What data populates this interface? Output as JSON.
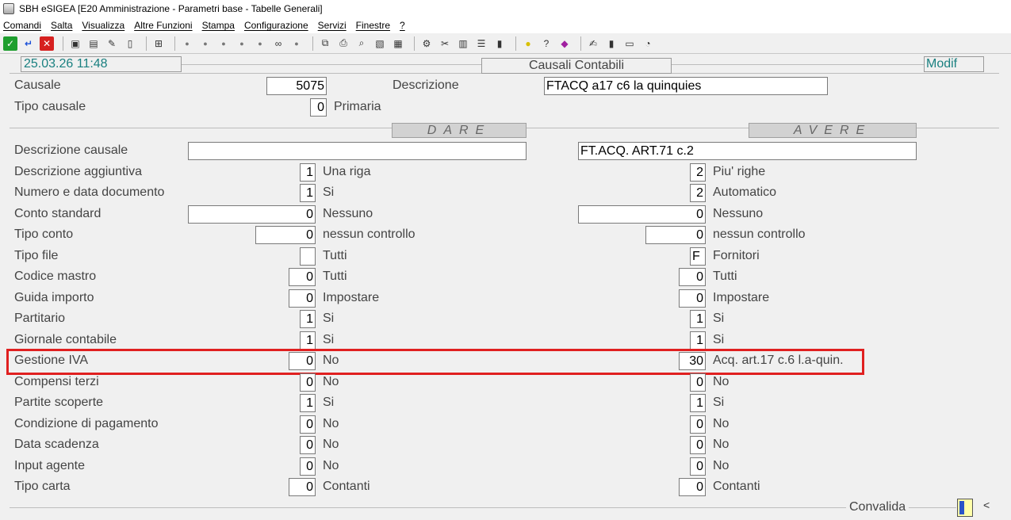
{
  "window": {
    "title": "SBH eSIGEA [E20 Amministrazione - Parametri base - Tabelle Generali]"
  },
  "menu": [
    "Comandi",
    "Salta",
    "Visualizza",
    "Altre Funzioni",
    "Stampa",
    "Configurazione",
    "Servizi",
    "Finestre",
    "?"
  ],
  "toolbar": {
    "icons": [
      "confirm-icon",
      "enter-icon",
      "cancel-icon",
      "record-icon",
      "record-next-icon",
      "edit-icon",
      "page-icon",
      "tree-icon",
      "f1-icon",
      "f2-icon",
      "f3-icon",
      "f4-icon",
      "f5-icon",
      "binoculars-icon",
      "f6-icon",
      "copy-icon",
      "print-icon",
      "print-preview-icon",
      "image-icon",
      "grid-icon",
      "settings-icon",
      "tools-icon",
      "report-icon",
      "list-icon",
      "chart-icon",
      "lightbulb-icon",
      "help-icon",
      "book-icon",
      "pen-icon",
      "device-icon",
      "monitor-icon",
      "clock-icon"
    ]
  },
  "header": {
    "datetime": "25.03.26 11:48",
    "form_title": "Causali Contabili",
    "mode": "Modif"
  },
  "top": {
    "causale_label": "Causale",
    "causale_value": "5075",
    "descrizione_label": "Descrizione",
    "descrizione_value": "FTACQ a17 c6 la quinquies",
    "tipo_causale_label": "Tipo causale",
    "tipo_causale_value": "0",
    "tipo_causale_desc": "Primaria"
  },
  "sections": {
    "dare": "DARE",
    "avere": "AVERE"
  },
  "rows": [
    {
      "label": "Descrizione causale",
      "dare_value": "",
      "dare_desc": "",
      "avere_value": "FT.ACQ. ART.71 c.2",
      "avere_desc": ""
    },
    {
      "label": "Descrizione aggiuntiva",
      "dare_value": "1",
      "dare_desc": "Una riga",
      "avere_value": "2",
      "avere_desc": "Piu' righe"
    },
    {
      "label": "Numero e data documento",
      "dare_value": "1",
      "dare_desc": "Si",
      "avere_value": "2",
      "avere_desc": "Automatico"
    },
    {
      "label": "Conto standard",
      "dare_value": "0",
      "dare_desc": "Nessuno",
      "avere_value": "0",
      "avere_desc": "Nessuno"
    },
    {
      "label": "Tipo conto",
      "dare_value": "0",
      "dare_desc": "nessun controllo",
      "avere_value": "0",
      "avere_desc": "nessun controllo"
    },
    {
      "label": "Tipo file",
      "dare_value": "",
      "dare_desc": "Tutti",
      "avere_value": "F",
      "avere_desc": "Fornitori"
    },
    {
      "label": "Codice mastro",
      "dare_value": "0",
      "dare_desc": "Tutti",
      "avere_value": "0",
      "avere_desc": "Tutti"
    },
    {
      "label": "Guida importo",
      "dare_value": "0",
      "dare_desc": "Impostare",
      "avere_value": "0",
      "avere_desc": "Impostare"
    },
    {
      "label": "Partitario",
      "dare_value": "1",
      "dare_desc": "Si",
      "avere_value": "1",
      "avere_desc": "Si"
    },
    {
      "label": "Giornale contabile",
      "dare_value": "1",
      "dare_desc": "Si",
      "avere_value": "1",
      "avere_desc": "Si"
    },
    {
      "label": "Gestione IVA",
      "dare_value": "0",
      "dare_desc": "No",
      "avere_value": "30",
      "avere_desc": "Acq. art.17 c.6 l.a-quin."
    },
    {
      "label": "Compensi terzi",
      "dare_value": "0",
      "dare_desc": "No",
      "avere_value": "0",
      "avere_desc": "No"
    },
    {
      "label": "Partite scoperte",
      "dare_value": "1",
      "dare_desc": "Si",
      "avere_value": "1",
      "avere_desc": "Si"
    },
    {
      "label": "Condizione di pagamento",
      "dare_value": "0",
      "dare_desc": "No",
      "avere_value": "0",
      "avere_desc": "No"
    },
    {
      "label": "Data scadenza",
      "dare_value": "0",
      "dare_desc": "No",
      "avere_value": "0",
      "avere_desc": "No"
    },
    {
      "label": "Input agente",
      "dare_value": "0",
      "dare_desc": "No",
      "avere_value": "0",
      "avere_desc": "No"
    },
    {
      "label": "Tipo carta",
      "dare_value": "0",
      "dare_desc": "Contanti",
      "avere_value": "0",
      "avere_desc": "Contanti"
    }
  ],
  "footer": {
    "convalida": "Convalida",
    "arrow": "<"
  }
}
